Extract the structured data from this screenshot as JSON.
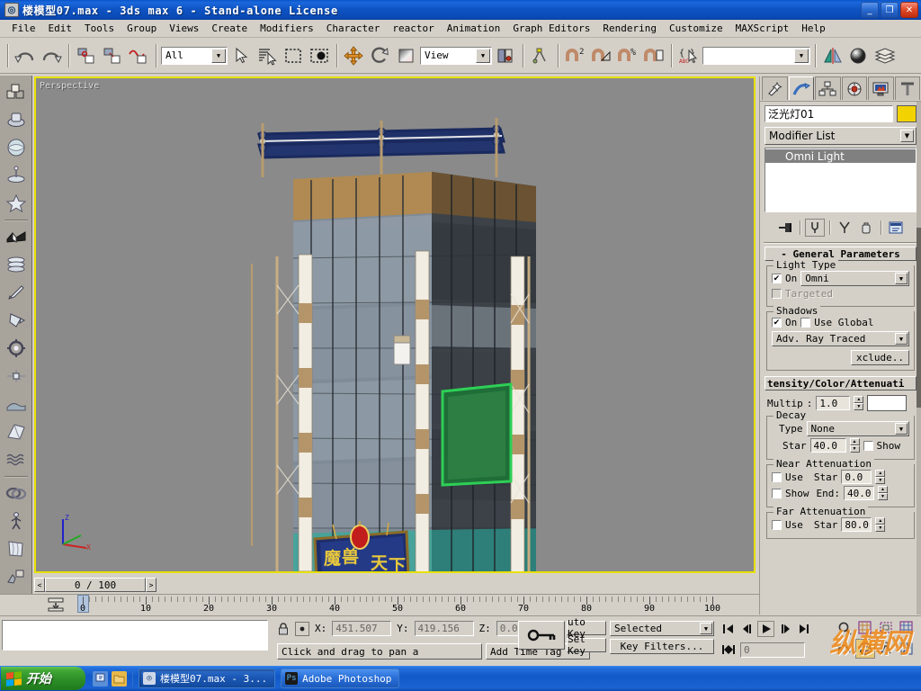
{
  "window": {
    "title": "楼模型07.max - 3ds max 6 - Stand-alone License",
    "app_icon": "max-logo-icon",
    "minimize_label": "_",
    "maximize_label": "❐",
    "close_label": "✕"
  },
  "menu": {
    "items": [
      {
        "label": "File"
      },
      {
        "label": "Edit"
      },
      {
        "label": "Tools"
      },
      {
        "label": "Group"
      },
      {
        "label": "Views"
      },
      {
        "label": "Create"
      },
      {
        "label": "Modifiers"
      },
      {
        "label": "Character"
      },
      {
        "label": "reactor"
      },
      {
        "label": "Animation"
      },
      {
        "label": "Graph Editors"
      },
      {
        "label": "Rendering"
      },
      {
        "label": "Customize"
      },
      {
        "label": "MAXScript"
      },
      {
        "label": "Help"
      }
    ]
  },
  "toolbar": {
    "undo": "undo-icon",
    "redo": "redo-icon",
    "select_link": "select-and-link-icon",
    "unlink": "unlink-selection-icon",
    "bind_space_warp": "bind-to-space-warp-icon",
    "selection_filter_value": "All",
    "select_object": "select-object-icon",
    "select_by_name": "select-by-name-icon",
    "select_region": "rectangular-selection-region-icon",
    "window_crossing": "window-crossing-icon",
    "select_move": "select-and-move-icon",
    "select_rotate": "select-and-rotate-icon",
    "select_scale": "select-and-scale-icon",
    "reference_coord_value": "View",
    "use_center": "use-pivot-point-center-icon",
    "mirror": "mirror-icon",
    "align": "align-icon",
    "manage_layers": "layer-manager-icon",
    "named_selection_sets_value": "",
    "curve_editor": "curve-editor-icon",
    "schematic_view": "schematic-view-icon",
    "material_editor": "material-editor-icon",
    "render_scene": "render-scene-icon",
    "snap_toggle": "snap-toggle-icon",
    "angle_snap": "angle-snap-icon",
    "percent_snap": "percent-snap-icon",
    "spinner_snap": "spinner-snap-icon"
  },
  "tab_panel": {
    "groups": [
      {
        "items": [
          {
            "icon": "standard-primitives-icon"
          },
          {
            "icon": "extended-primitives-icon"
          },
          {
            "icon": "compound-objects-icon"
          },
          {
            "icon": "particles-icon"
          },
          {
            "icon": "patch-grids-icon"
          }
        ]
      },
      {
        "items": [
          {
            "icon": "nurbs-surfaces-icon"
          },
          {
            "icon": "loft-objects-icon"
          },
          {
            "icon": "modifiers-edit-icon"
          },
          {
            "icon": "lights-cameras-icon"
          },
          {
            "icon": "helpers-icon"
          },
          {
            "icon": "space-warps-icon"
          },
          {
            "icon": "render-utilities-icon"
          },
          {
            "icon": "snapshot-icon"
          },
          {
            "icon": "wave-deform-icon"
          }
        ]
      },
      {
        "items": [
          {
            "icon": "dynamics-icon"
          },
          {
            "icon": "character-icon"
          },
          {
            "icon": "cloth-icon"
          },
          {
            "icon": "materials-icon"
          }
        ]
      }
    ]
  },
  "viewport": {
    "label": "Perspective",
    "axis_z": "Z",
    "axis_x": "X",
    "sign_text": "魔兽天下",
    "background_color": "#8a8a8a",
    "active_border_color": "#e8e000"
  },
  "command_panel": {
    "tabs": [
      {
        "icon": "create-tab-icon",
        "active": false
      },
      {
        "icon": "modify-tab-icon",
        "active": true
      },
      {
        "icon": "hierarchy-tab-icon",
        "active": false
      },
      {
        "icon": "motion-tab-icon",
        "active": false
      },
      {
        "icon": "display-tab-icon",
        "active": false
      },
      {
        "icon": "utilities-tab-icon",
        "active": false
      }
    ],
    "object_name": "泛光灯01",
    "object_color": "#f2d200",
    "modifier_list_label": "Modifier List",
    "stack": [
      {
        "label": "Omni Light",
        "selected": true
      }
    ],
    "stack_buttons": [
      {
        "icon": "pin-stack-icon"
      },
      {
        "icon": "show-end-result-icon"
      },
      {
        "icon": "make-unique-icon"
      },
      {
        "icon": "remove-modifier-icon"
      },
      {
        "icon": "configure-modifier-sets-icon"
      }
    ],
    "rollouts": {
      "general": {
        "title": "- General Parameters",
        "light_type_group": "Light Type",
        "on_label": "On",
        "on_checked": true,
        "light_type_value": "Omni",
        "targeted_label": "Targeted",
        "targeted_checked": false,
        "shadows_group": "Shadows",
        "shadow_on_label": "On",
        "shadow_on_checked": true,
        "use_global_label": "Use Global",
        "use_global_checked": false,
        "shadow_type_value": "Adv. Ray Traced",
        "exclude_button": "xclude.."
      },
      "intensity": {
        "title": "tensity/Color/Attenuati",
        "multiplier_label": "Multip",
        "multiplier_value": "1.0",
        "color_swatch": "#ffffff",
        "decay_group": "Decay",
        "decay_type_label": "Type",
        "decay_type_value": "None",
        "decay_start_label": "Star",
        "decay_start_value": "40.0",
        "decay_show_label": "Show",
        "decay_show_checked": false,
        "near_atten_group": "Near Attenuation",
        "near_use_label": "Use",
        "near_use_checked": false,
        "near_show_label": "Show",
        "near_show_checked": false,
        "near_start_label": "Star",
        "near_start_value": "0.0",
        "near_end_label": "End:",
        "near_end_value": "40.0",
        "far_atten_group": "Far Attenuation",
        "far_use_label": "Use",
        "far_use_checked": false,
        "far_start_label": "Star",
        "far_start_value": "80.0"
      }
    }
  },
  "timeline": {
    "prev_frame": "<",
    "next_frame": ">",
    "current_frame_display": "0 / 100",
    "ticks": [
      {
        "label": "0",
        "value": 0
      },
      {
        "label": "10",
        "value": 10
      },
      {
        "label": "20",
        "value": 20
      },
      {
        "label": "30",
        "value": 30
      },
      {
        "label": "40",
        "value": 40
      },
      {
        "label": "50",
        "value": 50
      },
      {
        "label": "60",
        "value": 60
      },
      {
        "label": "70",
        "value": 70
      },
      {
        "label": "80",
        "value": 80
      },
      {
        "label": "90",
        "value": 90
      },
      {
        "label": "100",
        "value": 100
      }
    ],
    "open_track_view_icon": "open-mini-curve-editor-icon"
  },
  "status_bar": {
    "lock_selection_icon": "lock-selection-icon",
    "absolute_mode_icon": "absolute-mode-transform-type-in-icon",
    "x_label": "X:",
    "x_value": "451.507",
    "y_label": "Y:",
    "y_value": "419.156",
    "z_label": "Z:",
    "z_value": "0.0",
    "prompt_text": "Click and drag to pan a",
    "add_time_tag": "Add Time Tag",
    "key_mode_icon": "key-mode-toggle-icon",
    "auto_key": "uto Key",
    "set_key": "Set Key",
    "filter_value": "Selected",
    "key_filters": "Key Filters...",
    "playback_frame_value": "0",
    "watermark": "纵横网"
  },
  "playback": {
    "go_to_start": "go-to-start-icon",
    "previous_frame": "previous-frame-icon",
    "play": "play-animation-icon",
    "next_frame": "next-frame-icon",
    "go_to_end": "go-to-end-icon",
    "key_mode": "key-mode-toggle-icon"
  },
  "view_nav": {
    "zoom": "zoom-icon",
    "zoom_all": "zoom-all-icon",
    "zoom_extents": "zoom-extents-icon",
    "zoom_region": "zoom-region-icon",
    "pan": "pan-view-icon",
    "arc_rotate": "arc-rotate-icon",
    "field_of_view": "field-of-view-icon",
    "min_max_toggle": "min-max-toggle-icon"
  },
  "taskbar": {
    "start_label": "开始",
    "quick_launch": [
      {
        "icon": "show-desktop-icon"
      },
      {
        "icon": "folder-icon"
      }
    ],
    "tasks": [
      {
        "icon": "max-logo-icon",
        "label": "楼模型07.max - 3...",
        "active": true
      },
      {
        "icon": "photoshop-icon",
        "label": "Adobe Photoshop",
        "active": false
      }
    ]
  }
}
